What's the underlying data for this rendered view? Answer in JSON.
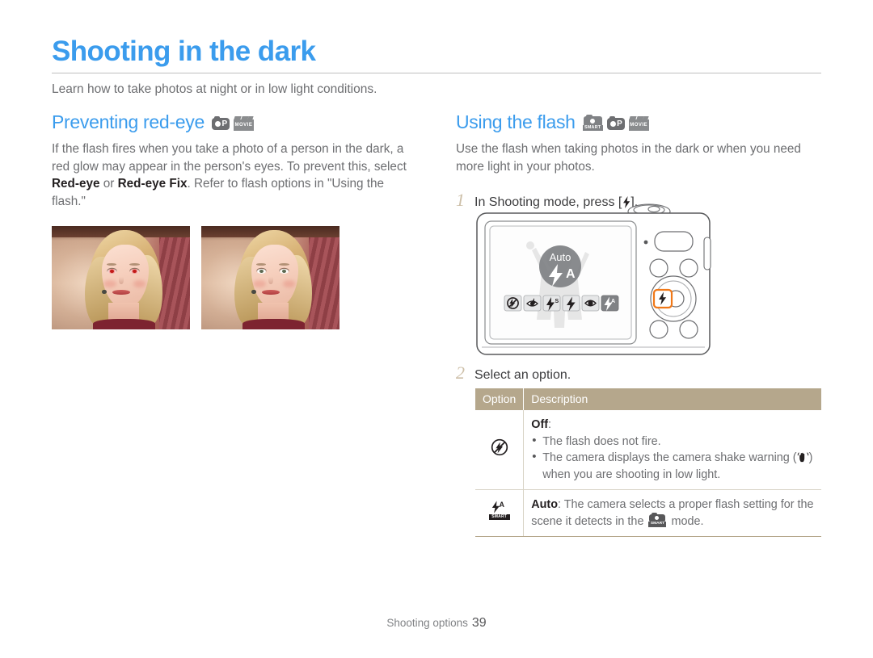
{
  "page": {
    "title": "Shooting in the dark",
    "subtitle": "Learn how to take photos at night or in low light conditions.",
    "accent_color": "#3b9ced",
    "table_header_color": "#b5a78c",
    "step_number_color": "#cdbfa8"
  },
  "left_column": {
    "heading": "Preventing red-eye",
    "mode_icons": [
      "program-mode-icon",
      "movie-mode-icon"
    ],
    "mode_icon_labels": [
      "P",
      "MOVIE"
    ],
    "paragraph_part1": "If the flash fires when you take a photo of a person in the dark, a red glow may appear in the person's eyes. To prevent this, select ",
    "bold1": "Red-eye",
    "paragraph_part2": " or ",
    "bold2": "Red-eye Fix",
    "paragraph_part3": ". Refer to flash options in \"Using the flash.\"",
    "photos": [
      {
        "name": "photo-with-red-eye",
        "eye_state": "red"
      },
      {
        "name": "photo-red-eye-corrected",
        "eye_state": "corrected"
      }
    ]
  },
  "right_column": {
    "heading": "Using the flash",
    "mode_icons": [
      "smart-auto-mode-icon",
      "program-mode-icon",
      "movie-mode-icon"
    ],
    "mode_icon_labels": [
      "SMART",
      "P",
      "MOVIE"
    ],
    "paragraph": "Use the flash when taking photos in the dark or when you need more light in your photos.",
    "steps": [
      {
        "num": "1",
        "text_before": "In Shooting mode, press [",
        "text_after": "]."
      },
      {
        "num": "2",
        "text": "Select an option."
      }
    ]
  },
  "camera": {
    "lcd_overlay_label": "Auto",
    "highlighted_button": "flash-button",
    "highlight_color": "#f07818",
    "flash_option_icons": [
      "flash-off-icon",
      "red-eye-icon",
      "slow-sync-icon",
      "fill-in-icon",
      "red-eye-fix-icon",
      "smart-auto-flash-icon"
    ],
    "selected_option_index": 5
  },
  "option_table": {
    "columns": [
      "Option",
      "Description"
    ],
    "rows": [
      {
        "icon": "flash-off-icon",
        "label": "Off",
        "label_suffix": ":",
        "bullets": [
          "The flash does not fire.",
          "The camera displays the camera shake warning (HAND) when you are shooting in low light."
        ],
        "bullet2_before": "The camera displays the camera shake warning (",
        "bullet2_after": ")",
        "bullet2_line2": "when you are shooting in low light."
      },
      {
        "icon": "smart-auto-flash-icon",
        "label": "Auto",
        "text_before": ": The camera selects a proper flash setting for the scene it detects in the ",
        "text_after": " mode."
      }
    ]
  },
  "footer": {
    "section": "Shooting options",
    "page_number": "39"
  }
}
